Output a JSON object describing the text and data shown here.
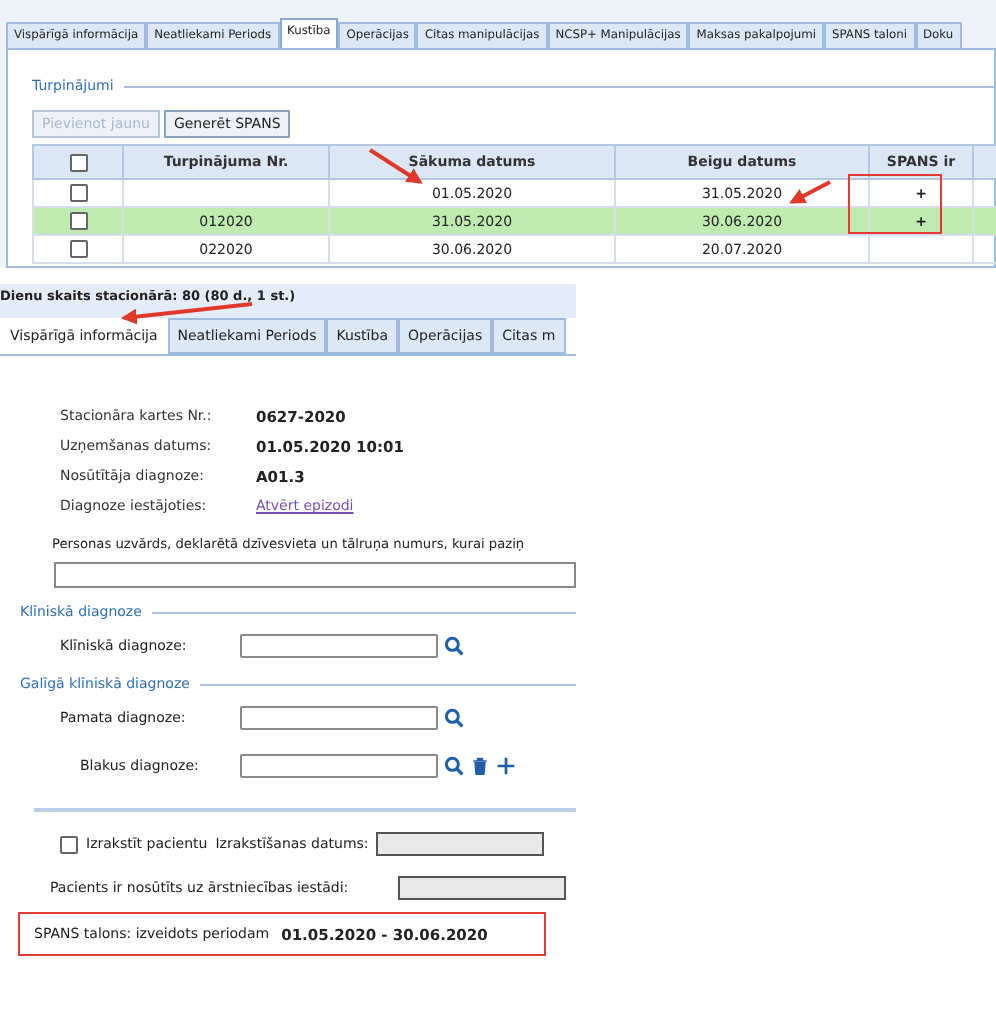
{
  "top_panel": {
    "tabs": [
      {
        "label": "Vispārīgā informācija",
        "selected": false
      },
      {
        "label": "Neatliekami Periods",
        "selected": false
      },
      {
        "label": "Kustība",
        "selected": true
      },
      {
        "label": "Operācijas",
        "selected": false
      },
      {
        "label": "Citas manipulācijas",
        "selected": false
      },
      {
        "label": "NCSP+ Manipulācijas",
        "selected": false
      },
      {
        "label": "Maksas pakalpojumi",
        "selected": false
      },
      {
        "label": "SPANS taloni",
        "selected": false
      },
      {
        "label": "Doku",
        "selected": false
      }
    ],
    "section_title": "Turpinājumi",
    "buttons": [
      {
        "label": "Pievienot jaunu",
        "disabled": true
      },
      {
        "label": "Generēt SPANS",
        "disabled": false
      }
    ],
    "table": {
      "header_checked": false,
      "columns": [
        "Turpinājuma Nr.",
        "Sākuma datums",
        "Beigu datums",
        "SPANS ir"
      ],
      "rows": [
        {
          "checked": false,
          "selected": false,
          "nr": "",
          "start": "01.05.2020",
          "end": "31.05.2020",
          "spans": "+"
        },
        {
          "checked": false,
          "selected": true,
          "nr": "012020",
          "start": "31.05.2020",
          "end": "30.06.2020",
          "spans": "+"
        },
        {
          "checked": false,
          "selected": false,
          "nr": "022020",
          "start": "30.06.2020",
          "end": "20.07.2020",
          "spans": ""
        }
      ]
    }
  },
  "bottom_panel": {
    "header": "Dienu skaits stacionārā: 80 (80 d., 1 st.)",
    "tabs": [
      {
        "label": "Vispārīgā informācija",
        "selected": true
      },
      {
        "label": "Neatliekami Periods",
        "selected": false
      },
      {
        "label": "Kustība",
        "selected": false
      },
      {
        "label": "Operācijas",
        "selected": false
      },
      {
        "label": "Citas m",
        "selected": false
      }
    ],
    "info": [
      {
        "label": "Stacionāra kartes Nr.:",
        "value": "0627-2020",
        "kind": "text"
      },
      {
        "label": "Uzņemšanas datums:",
        "value": "01.05.2020 10:01",
        "kind": "text"
      },
      {
        "label": "Nosūtītāja diagnoze:",
        "value": "A01.3",
        "kind": "text"
      },
      {
        "label": "Diagnoze iestājoties:",
        "value": "Atvērt epizodi",
        "kind": "link"
      }
    ],
    "contact_label": "Personas uzvārds, deklarētā dzīvesvieta un tālruņa numurs, kurai paziņ",
    "clinical_section": "Klīniskā diagnoze",
    "clinical_label": "Klīniskā diagnoze:",
    "final_section": "Galīgā klīniskā diagnoze",
    "main_label": "Pamata diagnoze:",
    "side_label": "Blakus diagnoze:",
    "discharge": {
      "checked": false,
      "label": "Izrakstīt pacientu",
      "date_label": "Izrakstīšanas datums:"
    },
    "referred_label": "Pacients ir nosūtīts uz ārstniecības iestādi:",
    "spans_label": "SPANS talons: izveidots periodam",
    "spans_period": "01.05.2020 - 30.06.2020"
  }
}
